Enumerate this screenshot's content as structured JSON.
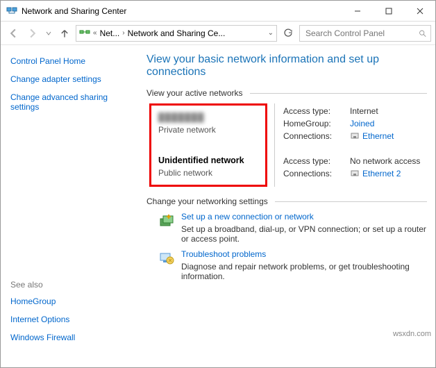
{
  "window": {
    "title": "Network and Sharing Center"
  },
  "breadcrumb": {
    "item1": "Net...",
    "item2": "Network and Sharing Ce..."
  },
  "search": {
    "placeholder": "Search Control Panel"
  },
  "sidebar": {
    "home": "Control Panel Home",
    "adapter": "Change adapter settings",
    "advanced": "Change advanced sharing settings",
    "see_also": "See also",
    "homegroup": "HomeGroup",
    "internet_options": "Internet Options",
    "firewall": "Windows Firewall"
  },
  "main": {
    "title": "View your basic network information and set up connections",
    "active_heading": "View your active networks",
    "net1": {
      "name_hidden": "███████",
      "subtitle": "Private network",
      "access_label": "Access type:",
      "access_val": "Internet",
      "hg_label": "HomeGroup:",
      "hg_val": "Joined",
      "conn_label": "Connections:",
      "conn_val": "Ethernet"
    },
    "net2": {
      "name": "Unidentified network",
      "subtitle": "Public network",
      "access_label": "Access type:",
      "access_val": "No network access",
      "conn_label": "Connections:",
      "conn_val": "Ethernet 2"
    },
    "settings_heading": "Change your networking settings",
    "setting1": {
      "title": "Set up a new connection or network",
      "desc": "Set up a broadband, dial-up, or VPN connection; or set up a router or access point."
    },
    "setting2": {
      "title": "Troubleshoot problems",
      "desc": "Diagnose and repair network problems, or get troubleshooting information."
    }
  },
  "watermark": "wsxdn.com"
}
